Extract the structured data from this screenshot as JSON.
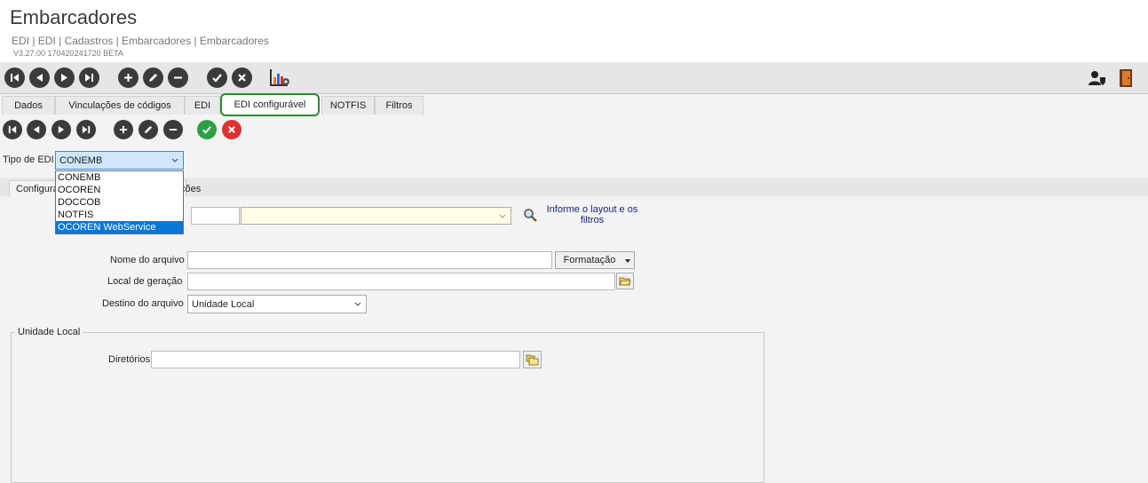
{
  "header": {
    "title": "Embarcadores",
    "breadcrumb": "EDI | EDI | Cadastros | Embarcadores | Embarcadores",
    "version": "V3.27.00 170420241720 BETA"
  },
  "toolbar": {
    "icons": [
      "first-icon",
      "previous-icon",
      "next-icon",
      "last-icon",
      "add-icon",
      "edit-icon",
      "remove-icon",
      "confirm-icon",
      "cancel-icon",
      "chart-settings-icon",
      "user-shield-icon",
      "exit-door-icon"
    ]
  },
  "tabs": [
    {
      "label": "Dados"
    },
    {
      "label": "Vinculações de códigos"
    },
    {
      "label": "EDI"
    },
    {
      "label": "EDI configurável"
    },
    {
      "label": "NOTFIS"
    },
    {
      "label": "Filtros"
    }
  ],
  "form": {
    "tipo_edi_label": "Tipo de EDI",
    "tipo_edi_value": "CONEMB",
    "tipo_edi_options": [
      "CONEMB",
      "OCOREN",
      "DOCCOB",
      "NOTFIS",
      "OCOREN WebService"
    ],
    "tipo_edi_highlighted": "OCOREN WebService",
    "subtab_config": "Configura",
    "subtab_opcoes": "ções",
    "layout_hint_line1": "Informe o layout e os",
    "layout_hint_line2": "filtros",
    "nome_arquivo_label": "Nome do arquivo",
    "nome_arquivo_value": "",
    "formatacao_label": "Formatação",
    "local_geracao_label": "Local de geração",
    "local_geracao_value": "",
    "destino_label": "Destino do arquivo",
    "destino_value": "Unidade Local",
    "unidade_local_legend": "Unidade Local",
    "diretorios_label": "Diretórios",
    "diretorios_value": ""
  },
  "colors": {
    "active_tab_border": "#2e8b2e",
    "confirm_green": "#2ea043",
    "cancel_red": "#e03131",
    "selection_blue": "#0a76d6",
    "layout_field_bg": "#ffffe6"
  }
}
